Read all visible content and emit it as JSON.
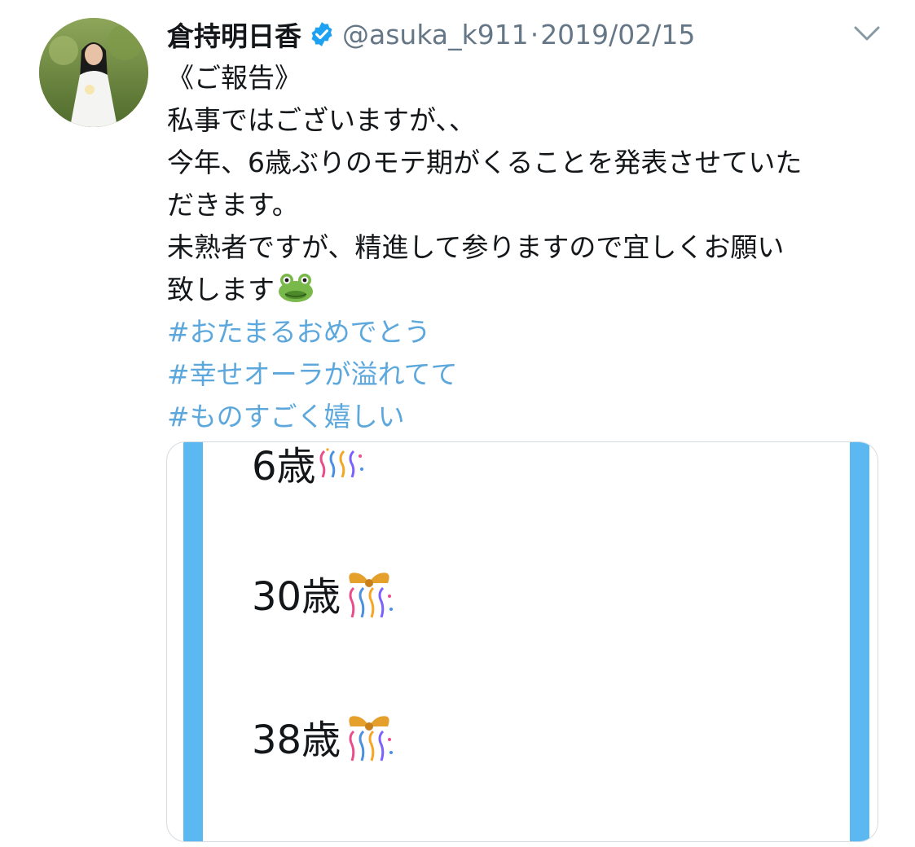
{
  "tweet": {
    "display_name": "倉持明日香",
    "verified_icon": "verified-badge-icon",
    "handle": "@asuka_k911",
    "separator": "·",
    "date": "2019/02/15",
    "menu_icon": "chevron-down-icon",
    "lines": [
      "《ご報告》",
      "私事ではございますが、、",
      "今年、6歳ぶりのモテ期がくることを発表させていた",
      "だきます。",
      "未熟者ですが、精進して参りますので宜しくお願い",
      "致します"
    ],
    "hashtags": [
      "#おたまるおめでとう",
      "#幸せオーラが溢れてて",
      "#ものすごく嬉しい"
    ]
  },
  "media": {
    "ages": [
      "6歳",
      "30歳",
      "38歳"
    ]
  },
  "colors": {
    "text": "#14171a",
    "secondary": "#657786",
    "hashtag": "#5ca7dc",
    "verified": "#1da1f2",
    "stripe": "#5bb8f0"
  }
}
